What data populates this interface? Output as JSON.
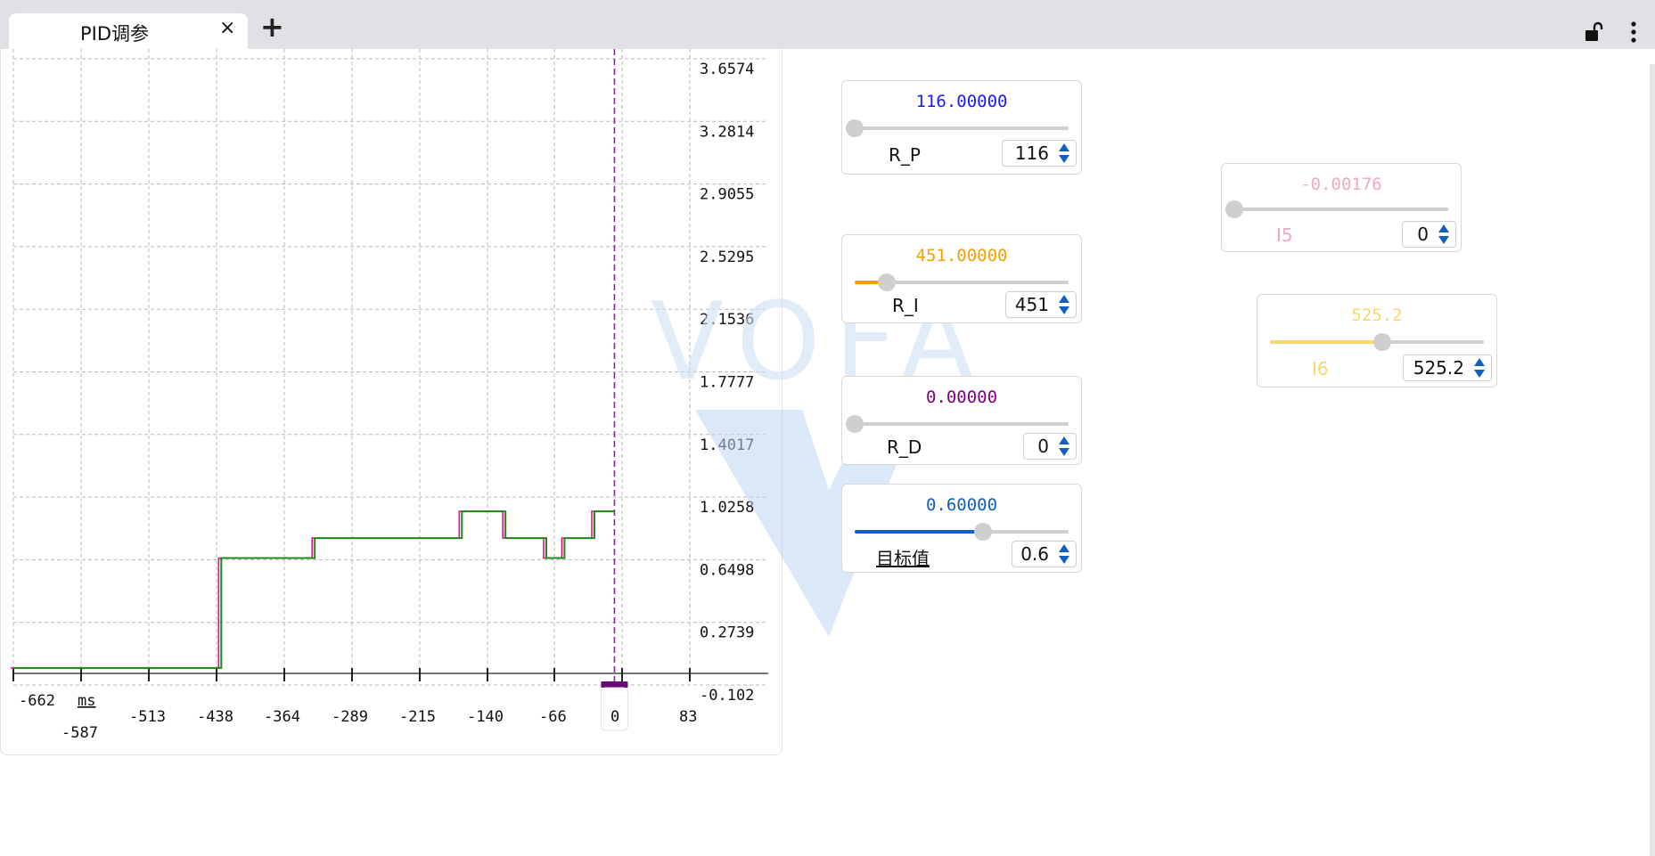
{
  "tabs": [
    {
      "label": "PID调参",
      "close": "×"
    }
  ],
  "add_tab_label": "+",
  "plot": {
    "y_ticks": [
      "3.6574",
      "3.2814",
      "2.9055",
      "2.5295",
      "2.1536",
      "1.7777",
      "1.4017",
      "1.0258",
      "0.6498",
      "0.2739",
      "-0.102"
    ],
    "x_ticks_row1": [
      "-662",
      "ms",
      "-513",
      "-438",
      "-364",
      "-289",
      "-215",
      "-140",
      "-66",
      "0",
      "83"
    ],
    "x_tick_row2": "-587",
    "cursor_value": "0",
    "series": [
      {
        "name": "",
        "color": "#e8108a"
      },
      {
        "name": "",
        "color": "#1a8a1a"
      }
    ],
    "chart_data": {
      "type": "line",
      "x": [
        -662,
        -433,
        -433,
        -330,
        -330,
        -168,
        -168,
        -120,
        -120,
        -75,
        -75,
        -55,
        -55,
        -22,
        -22,
        0
      ],
      "y": [
        0,
        0,
        0.66,
        0.66,
        0.78,
        0.78,
        0.94,
        0.94,
        0.78,
        0.78,
        0.66,
        0.66,
        0.78,
        0.78,
        0.94,
        0.94
      ],
      "xlim": [
        -662,
        83
      ],
      "ylim": [
        -0.102,
        3.6574
      ],
      "xlabel": "ms",
      "grid": true
    }
  },
  "widgets": [
    {
      "id": "rp",
      "value": "116.00000",
      "color": "#1a1aff",
      "fraction": 0.0,
      "label": "R_P",
      "spin": "116"
    },
    {
      "id": "ri",
      "value": "451.00000",
      "color": "#f5a000",
      "fraction": 0.15,
      "label": "R_I",
      "spin": "451"
    },
    {
      "id": "rd",
      "value": "0.00000",
      "color": "#800080",
      "fraction": 0.0,
      "label": "R_D",
      "spin": "0"
    },
    {
      "id": "target",
      "value": "0.60000",
      "color": "#1060c0",
      "fraction": 0.6,
      "label": "目标值",
      "spin": "0.6"
    },
    {
      "id": "i5",
      "value": "-0.00176",
      "color": "#f4a8c0",
      "fraction": 0.0,
      "label": "I5",
      "spin": "0"
    },
    {
      "id": "i6",
      "value": "525.2",
      "color": "#f8d868",
      "fraction": 0.525,
      "label": "I6",
      "spin": "525.2"
    }
  ],
  "watermark_text": "VOFA",
  "icons": {
    "lock": "unlocked-lock-icon",
    "more": "more-vert-icon"
  }
}
